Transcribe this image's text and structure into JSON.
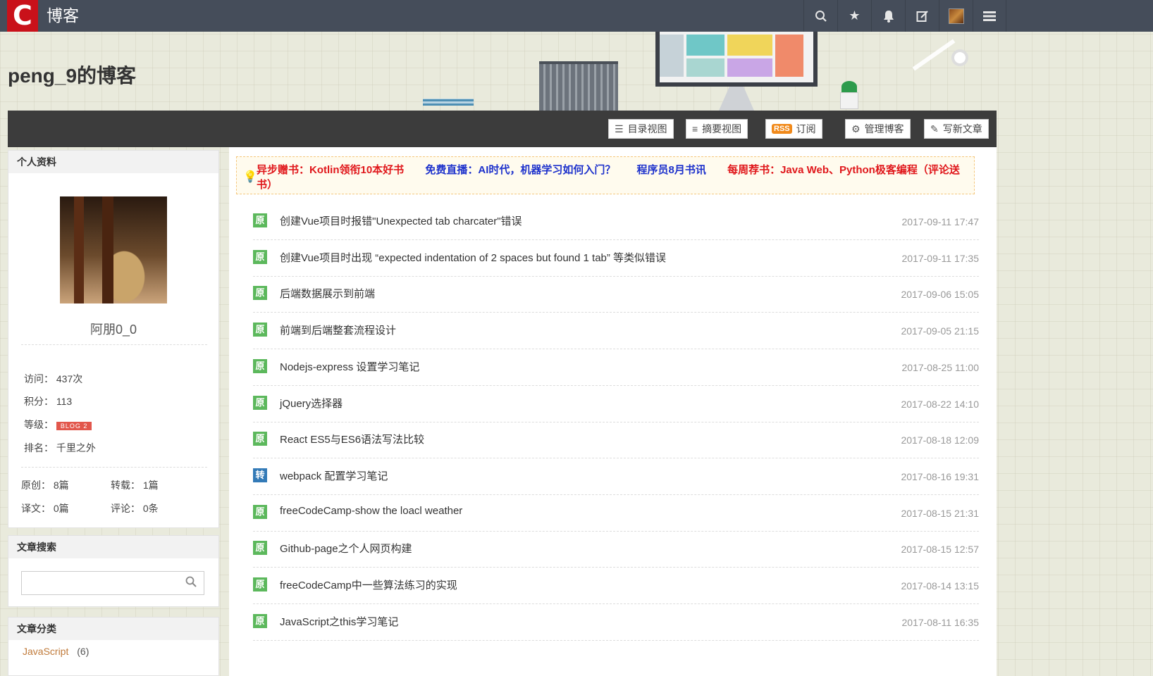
{
  "topbar": {
    "logo": "C",
    "site_title": "博客",
    "icons": [
      "search-icon",
      "star-icon",
      "bell-icon",
      "edit-icon",
      "avatar",
      "menu-icon"
    ]
  },
  "blog_title": "peng_9的博客",
  "toolbar": {
    "catalog_view": "目录视图",
    "summary_view": "摘要视图",
    "rss_badge": "RSS",
    "subscribe": "订阅",
    "manage_blog": "管理博客",
    "write_article": "写新文章"
  },
  "profile": {
    "heading": "个人资料",
    "username": "阿朋0_0",
    "visits_label": "访问：",
    "visits": "437次",
    "points_label": "积分：",
    "points": "113",
    "level_label": "等级：",
    "level_badge": "BLOG 2",
    "rank_label": "排名：",
    "rank": "千里之外",
    "original_label": "原创：",
    "original": "8篇",
    "repost_label": "转载：",
    "repost": "1篇",
    "translate_label": "译文：",
    "translate": "0篇",
    "comments_label": "评论：",
    "comments": "0条"
  },
  "search": {
    "heading": "文章搜索",
    "placeholder": ""
  },
  "categories": {
    "heading": "文章分类",
    "first_item": "JavaScript",
    "first_count": "(6)"
  },
  "notice": {
    "items": [
      {
        "text": "异步赠书：Kotlin领衔10本好书",
        "color": "#e0171b"
      },
      {
        "text": "免费直播：AI时代，机器学习如何入门？",
        "color": "#1e32cc"
      },
      {
        "text": "程序员8月书讯",
        "color": "#1e32cc"
      },
      {
        "text": "每周荐书：Java Web、Python极客编程（评论送书）",
        "color": "#e0171b"
      }
    ]
  },
  "tags": {
    "original": "原",
    "repost": "转"
  },
  "articles": [
    {
      "type": "original",
      "title": "创建Vue项目时报错\"Unexpected tab charcater\"错误",
      "date": "2017-09-11 17:47"
    },
    {
      "type": "original",
      "title": "创建Vue项目时出现 “expected indentation of 2 spaces but found 1 tab” 等类似错误",
      "date": "2017-09-11 17:35"
    },
    {
      "type": "original",
      "title": "后端数据展示到前端",
      "date": "2017-09-06 15:05"
    },
    {
      "type": "original",
      "title": "前端到后端整套流程设计",
      "date": "2017-09-05 21:15"
    },
    {
      "type": "original",
      "title": "Nodejs-express 设置学习笔记",
      "date": "2017-08-25 11:00"
    },
    {
      "type": "original",
      "title": "jQuery选择器",
      "date": "2017-08-22 14:10"
    },
    {
      "type": "original",
      "title": "React ES5与ES6语法写法比较",
      "date": "2017-08-18 12:09"
    },
    {
      "type": "repost",
      "title": "webpack 配置学习笔记",
      "date": "2017-08-16 19:31"
    },
    {
      "type": "original",
      "title": "freeCodeCamp-show the loacl weather",
      "date": "2017-08-15 21:31"
    },
    {
      "type": "original",
      "title": "Github-page之个人网页构建",
      "date": "2017-08-15 12:57"
    },
    {
      "type": "original",
      "title": "freeCodeCamp中一些算法练习的实现",
      "date": "2017-08-14 13:15"
    },
    {
      "type": "original",
      "title": "JavaScript之this学习笔记",
      "date": "2017-08-11 16:35"
    }
  ]
}
